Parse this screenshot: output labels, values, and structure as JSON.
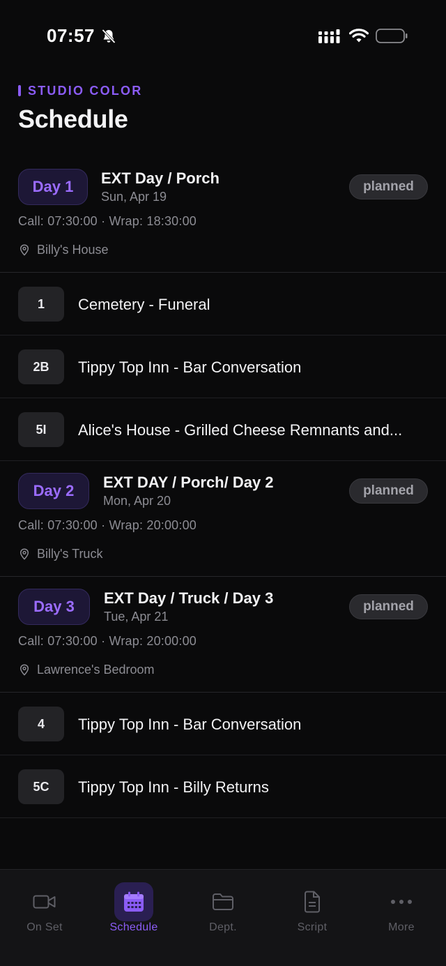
{
  "status_bar": {
    "time": "07:57"
  },
  "header": {
    "eyebrow": "STUDIO COLOR",
    "title": "Schedule"
  },
  "days": [
    {
      "pill": "Day 1",
      "title": "EXT Day / Porch",
      "date": "Sun, Apr 19",
      "status": "planned",
      "call_wrap": "Call: 07:30:00 · Wrap: 18:30:00",
      "location": "Billy's House",
      "scenes": [
        {
          "num": "1",
          "title": "Cemetery - Funeral"
        },
        {
          "num": "2B",
          "title": "Tippy Top Inn - Bar Conversation"
        },
        {
          "num": "5I",
          "title": "Alice's House - Grilled Cheese Remnants and..."
        }
      ]
    },
    {
      "pill": "Day 2",
      "title": "EXT DAY / Porch/ Day 2",
      "date": "Mon, Apr 20",
      "status": "planned",
      "call_wrap": "Call: 07:30:00 · Wrap: 20:00:00",
      "location": "Billy's Truck",
      "scenes": []
    },
    {
      "pill": "Day 3",
      "title": "EXT Day / Truck / Day 3",
      "date": "Tue, Apr 21",
      "status": "planned",
      "call_wrap": "Call: 07:30:00 · Wrap: 20:00:00",
      "location": "Lawrence's Bedroom",
      "scenes": [
        {
          "num": "4",
          "title": "Tippy Top Inn - Bar Conversation"
        },
        {
          "num": "5C",
          "title": "Tippy Top Inn - Billy Returns"
        }
      ]
    }
  ],
  "tabs": [
    {
      "label": "On Set",
      "icon": "video-camera-icon"
    },
    {
      "label": "Schedule",
      "icon": "calendar-icon",
      "active": true
    },
    {
      "label": "Dept.",
      "icon": "folder-icon"
    },
    {
      "label": "Script",
      "icon": "document-icon"
    },
    {
      "label": "More",
      "icon": "more-dots-icon"
    }
  ],
  "colors": {
    "accent": "#8b5cf6",
    "background": "#0a0a0b",
    "badge_bg": "#2a2a2e"
  }
}
